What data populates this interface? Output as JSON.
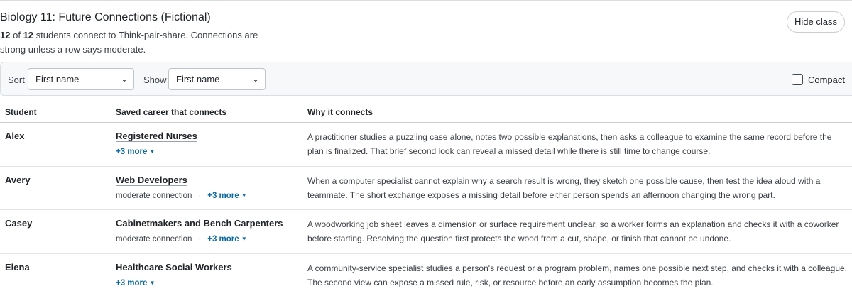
{
  "header": {
    "title": "Biology 11: Future Connections (Fictional)",
    "count_a": "12",
    "of_text": "of",
    "count_b": "12",
    "summary_rest": "students connect to Think-pair-share. Connections are strong unless a row says moderate.",
    "hide_button": "Hide class"
  },
  "controls": {
    "sort_label": "Sort",
    "sort_value": "First name",
    "show_label": "Show",
    "show_value": "First name",
    "compact_label": "Compact",
    "compact_checked": false
  },
  "table": {
    "headers": {
      "student": "Student",
      "career": "Saved career that connects",
      "why": "Why it connects"
    },
    "rows": [
      {
        "student": "Alex",
        "career": "Registered Nurses",
        "moderate": "",
        "more": "+3 more",
        "why": "A practitioner studies a puzzling case alone, notes two possible explanations, then asks a colleague to examine the same record before the plan is finalized. That brief second look can reveal a missed detail while there is still time to change course."
      },
      {
        "student": "Avery",
        "career": "Web Developers",
        "moderate": "moderate connection",
        "more": "+3 more",
        "why": "When a computer specialist cannot explain why a search result is wrong, they sketch one possible cause, then test the idea aloud with a teammate. The short exchange exposes a missing detail before either person spends an afternoon changing the wrong part."
      },
      {
        "student": "Casey",
        "career": "Cabinetmakers and Bench Carpenters",
        "moderate": "moderate connection",
        "more": "+3 more",
        "why": "A woodworking job sheet leaves a dimension or surface requirement unclear, so a worker forms an explanation and checks it with a coworker before starting. Resolving the question first protects the wood from a cut, shape, or finish that cannot be undone."
      },
      {
        "student": "Elena",
        "career": "Healthcare Social Workers",
        "moderate": "",
        "more": "+3 more",
        "why": "A community-service specialist studies a person's request or a program problem, names one possible next step, and checks it with a colleague. The second view can expose a missed rule, risk, or resource before an early assumption becomes the plan."
      }
    ]
  }
}
